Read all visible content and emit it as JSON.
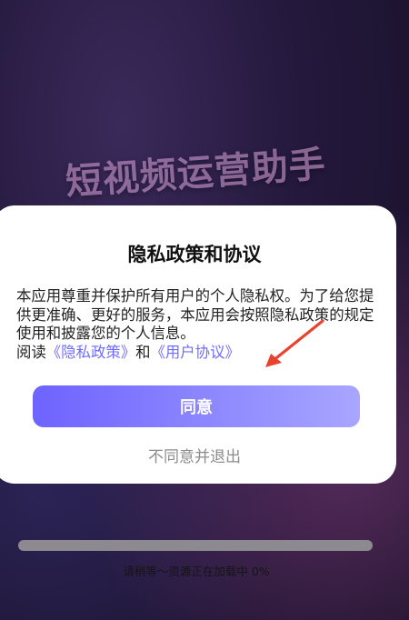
{
  "background": {
    "app_title": "短视频运营助手"
  },
  "dialog": {
    "title": "隐私政策和协议",
    "body_text": "本应用尊重并保护所有用户的个人隐私权。为了给您提供更准确、更好的服务，本应用会按照隐私政策的规定使用和披露您的个人信息。",
    "read_prefix": "阅读",
    "privacy_link": "《隐私政策》",
    "conjunction": "和",
    "user_agreement_link": "《用户协议》",
    "agree_button": "同意",
    "disagree_button": "不同意并退出"
  },
  "loading": {
    "text": "请稍等～资源正在加载中 0%",
    "progress_percent": 0
  },
  "colors": {
    "link": "#6f6cff",
    "button_gradient_start": "#6d63ff",
    "button_gradient_end": "#a8a6ff",
    "annotation_arrow": "#e8432f"
  }
}
